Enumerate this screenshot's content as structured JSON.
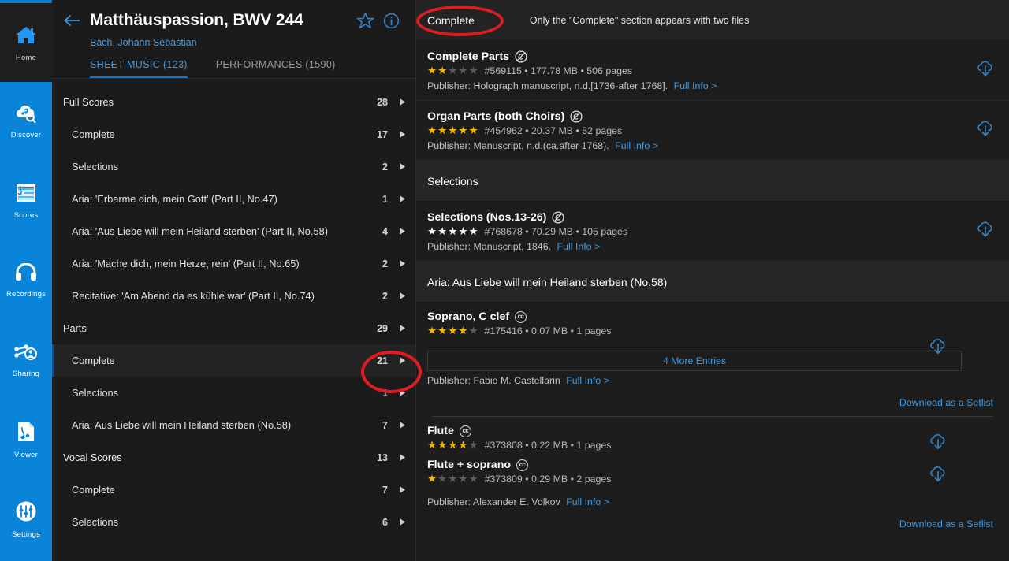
{
  "app": {
    "rail": {
      "items": [
        {
          "label": "Home",
          "icon": "home-icon",
          "active": true
        },
        {
          "label": "Discover",
          "icon": "discover-icon",
          "active": false
        },
        {
          "label": "Scores",
          "icon": "scores-icon",
          "active": false
        },
        {
          "label": "Recordings",
          "icon": "recordings-icon",
          "active": false
        },
        {
          "label": "Sharing",
          "icon": "sharing-icon",
          "active": false
        },
        {
          "label": "Viewer",
          "icon": "viewer-icon",
          "active": false
        },
        {
          "label": "Settings",
          "icon": "settings-icon",
          "active": false
        }
      ],
      "accent_color": "#0a84d8"
    }
  },
  "work": {
    "title": "Matthäuspassion, BWV 244",
    "composer": "Bach, Johann Sebastian",
    "back_icon": "back-arrow-icon",
    "favorite_icon": "star-outline-icon",
    "info_icon": "info-circle-icon",
    "tabs": [
      {
        "label": "SHEET MUSIC (123)",
        "active": true
      },
      {
        "label": "PERFORMANCES (1590)",
        "active": false
      }
    ]
  },
  "tree": [
    {
      "label": "Full Scores",
      "count": "28",
      "level": 0,
      "selected": false
    },
    {
      "label": "Complete",
      "count": "17",
      "level": 1,
      "selected": false
    },
    {
      "label": "Selections",
      "count": "2",
      "level": 1,
      "selected": false
    },
    {
      "label": "Aria: 'Erbarme dich, mein Gott' (Part II, No.47)",
      "count": "1",
      "level": 1,
      "selected": false
    },
    {
      "label": "Aria: 'Aus Liebe will mein Heiland sterben' (Part II, No.58)",
      "count": "4",
      "level": 1,
      "selected": false
    },
    {
      "label": "Aria: 'Mache dich, mein Herze, rein' (Part II, No.65)",
      "count": "2",
      "level": 1,
      "selected": false
    },
    {
      "label": "Recitative: 'Am Abend da es kühle war' (Part II, No.74)",
      "count": "2",
      "level": 1,
      "selected": false
    },
    {
      "label": "Parts",
      "count": "29",
      "level": 0,
      "selected": false
    },
    {
      "label": "Complete",
      "count": "21",
      "level": 1,
      "selected": true
    },
    {
      "label": "Selections",
      "count": "1",
      "level": 1,
      "selected": false
    },
    {
      "label": "Aria: Aus Liebe will mein Heiland sterben (No.58)",
      "count": "7",
      "level": 1,
      "selected": false
    },
    {
      "label": "Vocal Scores",
      "count": "13",
      "level": 0,
      "selected": false
    },
    {
      "label": "Complete",
      "count": "7",
      "level": 1,
      "selected": false
    },
    {
      "label": "Selections",
      "count": "6",
      "level": 1,
      "selected": false
    }
  ],
  "results": {
    "section1": {
      "title": "Complete",
      "note": "Only the \"Complete\" section appears with two files",
      "entries": [
        {
          "title": "Complete Parts",
          "badge": "public-domain-icon",
          "rating": 2,
          "rating_style": "gold",
          "id": "#569115",
          "size": "177.78 MB",
          "pages": "506 pages",
          "meta": "#569115 • 177.78 MB • 506 pages",
          "publisher": "Publisher: Holograph manuscript, n.d.[1736-after 1768].",
          "full_info": "Full Info >",
          "download_icon": "cloud-download-icon"
        },
        {
          "title": "Organ Parts (both Choirs)",
          "badge": "public-domain-icon",
          "rating": 5,
          "rating_style": "gold",
          "id": "#454962",
          "size": "20.37 MB",
          "pages": "52 pages",
          "meta": "#454962 • 20.37 MB • 52 pages",
          "publisher": "Publisher: Manuscript, n.d.(ca.after 1768).",
          "full_info": "Full Info >",
          "download_icon": "cloud-download-icon"
        }
      ]
    },
    "section2": {
      "title": "Selections",
      "entries": [
        {
          "title": "Selections (Nos.13-26)",
          "badge": "public-domain-icon",
          "rating": 0,
          "rating_style": "white",
          "id": "#768678",
          "size": "70.29 MB",
          "pages": "105 pages",
          "meta": "#768678 • 70.29 MB • 105 pages",
          "publisher": "Publisher: Manuscript, 1846.",
          "full_info": "Full Info >",
          "download_icon": "cloud-download-icon"
        }
      ]
    },
    "section3": {
      "title": "Aria: Aus Liebe will mein Heiland sterben (No.58)",
      "group_a": {
        "entries": [
          {
            "title": "Soprano, C clef",
            "badge": "creative-commons-icon",
            "rating": 4,
            "rating_style": "gold",
            "id": "#175416",
            "size": "0.07 MB",
            "pages": "1 pages",
            "meta": "#175416 • 0.07 MB • 1 pages",
            "download_icon": "cloud-download-icon"
          }
        ],
        "more_entries": "4 More Entries",
        "publisher": "Publisher: Fabio M. Castellarin",
        "full_info": "Full Info >",
        "setlist": "Download as a Setlist"
      },
      "group_b": {
        "entries": [
          {
            "title": "Flute",
            "badge": "creative-commons-icon",
            "rating": 4,
            "rating_style": "gold",
            "id": "#373808",
            "size": "0.22 MB",
            "pages": "1 pages",
            "meta": "#373808 • 0.22 MB • 1 pages",
            "download_icon": "cloud-download-icon"
          },
          {
            "title": "Flute + soprano",
            "badge": "creative-commons-icon",
            "rating": 1,
            "rating_style": "gold",
            "id": "#373809",
            "size": "0.29 MB",
            "pages": "2 pages",
            "meta": "#373809 • 0.29 MB • 2 pages",
            "download_icon": "cloud-download-icon"
          }
        ],
        "publisher": "Publisher: Alexander E. Volkov",
        "full_info": "Full Info >",
        "setlist": "Download as a Setlist"
      }
    }
  },
  "annotations": {
    "color": "#e01b22",
    "oval_complete_target": "Complete",
    "oval_count_target": "21"
  }
}
